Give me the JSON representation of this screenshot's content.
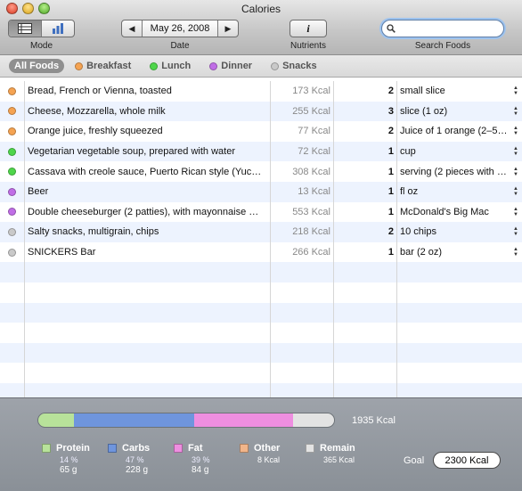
{
  "window": {
    "title": "Calories"
  },
  "toolbar": {
    "mode_label": "Mode",
    "date_label": "Date",
    "date_value": "May 26, 2008",
    "nutrients_label": "Nutrients",
    "nutrients_icon": "i",
    "search_label": "Search Foods",
    "search_value": ""
  },
  "filters": {
    "all": "All Foods",
    "breakfast": "Breakfast",
    "lunch": "Lunch",
    "dinner": "Dinner",
    "snacks": "Snacks"
  },
  "colors": {
    "breakfast": "#f5a352",
    "lunch": "#4fd64b",
    "dinner": "#c06ee6",
    "snacks": "#c9c9c9",
    "protein": "#b8e29a",
    "carbs": "#6f95dd",
    "fat": "#ee8ee0",
    "other": "#f1b58a",
    "remain": "#e3e3e3"
  },
  "foods": [
    {
      "meal": "breakfast",
      "name": "Bread, French or Vienna, toasted",
      "kcal": "173 Kcal",
      "qty": "2",
      "unit": "small slice"
    },
    {
      "meal": "breakfast",
      "name": "Cheese, Mozzarella, whole milk",
      "kcal": "255 Kcal",
      "qty": "3",
      "unit": "slice (1 oz)"
    },
    {
      "meal": "breakfast",
      "name": "Orange juice, freshly squeezed",
      "kcal": "77 Kcal",
      "qty": "2",
      "unit": "Juice of 1 orange (2–5…"
    },
    {
      "meal": "lunch",
      "name": "Vegetarian vegetable soup, prepared with water",
      "kcal": "72 Kcal",
      "qty": "1",
      "unit": "cup"
    },
    {
      "meal": "lunch",
      "name": "Cassava with creole sauce, Puerto Rican style (Yuc…",
      "kcal": "308 Kcal",
      "qty": "1",
      "unit": "serving (2 pieces with …"
    },
    {
      "meal": "dinner",
      "name": "Beer",
      "kcal": "13 Kcal",
      "qty": "1",
      "unit": "fl oz"
    },
    {
      "meal": "dinner",
      "name": "Double cheeseburger (2 patties), with mayonnaise …",
      "kcal": "553 Kcal",
      "qty": "1",
      "unit": "McDonald's Big Mac"
    },
    {
      "meal": "snacks",
      "name": "Salty snacks, multigrain, chips",
      "kcal": "218 Kcal",
      "qty": "2",
      "unit": "10 chips"
    },
    {
      "meal": "snacks",
      "name": "SNICKERS Bar",
      "kcal": "266 Kcal",
      "qty": "1",
      "unit": "bar (2 oz)"
    }
  ],
  "summary": {
    "total": "1935 Kcal",
    "bar_fractions": {
      "protein": 0.14,
      "carbs": 0.47,
      "fat": 0.39,
      "other": 0.0,
      "remain": 0.16
    },
    "protein": {
      "label": "Protein",
      "pct": "14 %",
      "grams": "65 g"
    },
    "carbs": {
      "label": "Carbs",
      "pct": "47 %",
      "grams": "228 g"
    },
    "fat": {
      "label": "Fat",
      "pct": "39 %",
      "grams": "84 g"
    },
    "other": {
      "label": "Other",
      "value": "8 Kcal"
    },
    "remain": {
      "label": "Remain",
      "value": "365 Kcal"
    },
    "goal_label": "Goal",
    "goal_value": "2300 Kcal"
  }
}
